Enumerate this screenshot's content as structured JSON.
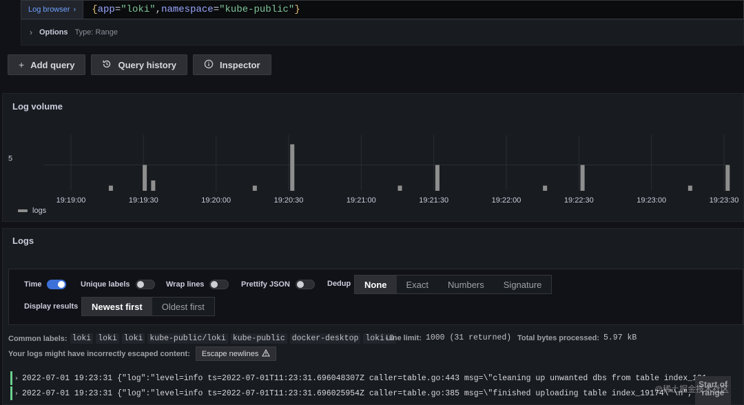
{
  "query": {
    "log_browser_label": "Log browser",
    "log_browser_chevron": "›",
    "tokens": [
      {
        "t": "{",
        "c": "q-brace"
      },
      {
        "t": "app",
        "c": "q-key"
      },
      {
        "t": "=",
        "c": "q-op"
      },
      {
        "t": "\"loki\"",
        "c": "q-val"
      },
      {
        "t": ",",
        "c": "q-op"
      },
      {
        "t": "namespace",
        "c": "q-key"
      },
      {
        "t": "=",
        "c": "q-op"
      },
      {
        "t": "\"kube-public\"",
        "c": "q-val"
      },
      {
        "t": "}",
        "c": "q-brace"
      }
    ],
    "options_label": "Options",
    "options_type": "Type: Range"
  },
  "toolbar": {
    "add_query": "Add query",
    "query_history": "Query history",
    "inspector": "Inspector"
  },
  "volume": {
    "title": "Log volume",
    "legend": "logs",
    "colors": {
      "bar": "#8e8e8e",
      "grid": "#2a2d33",
      "text": "#ccccdc"
    }
  },
  "chart_data": {
    "type": "bar",
    "title": "Log volume",
    "xlabel": "",
    "ylabel": "",
    "y_ticks": [
      5
    ],
    "ylim": [
      0,
      10
    ],
    "x_ticks": [
      "19:19:00",
      "19:19:30",
      "19:20:00",
      "19:20:30",
      "19:21:00",
      "19:21:30",
      "19:22:00",
      "19:22:30",
      "19:23:00",
      "19:23:30"
    ],
    "x_range_seconds": [
      0,
      270
    ],
    "grid": true,
    "legend_position": "bottom-left",
    "series": [
      {
        "name": "logs",
        "points": [
          {
            "t": 16.5,
            "v": 1
          },
          {
            "t": 30.5,
            "v": 5
          },
          {
            "t": 34,
            "v": 2
          },
          {
            "t": 76,
            "v": 1
          },
          {
            "t": 91.5,
            "v": 9
          },
          {
            "t": 136,
            "v": 1
          },
          {
            "t": 151.5,
            "v": 5
          },
          {
            "t": 196,
            "v": 1
          },
          {
            "t": 211.5,
            "v": 5
          },
          {
            "t": 256,
            "v": 1
          },
          {
            "t": 271.5,
            "v": 5
          }
        ]
      }
    ]
  },
  "logs": {
    "title": "Logs",
    "controls": {
      "time_label": "Time",
      "time_on": true,
      "unique_labels_label": "Unique labels",
      "unique_labels_on": false,
      "wrap_lines_label": "Wrap lines",
      "wrap_lines_on": false,
      "prettify_json_label": "Prettify JSON",
      "prettify_json_on": false,
      "dedup_label": "Dedup",
      "dedup_options": [
        "None",
        "Exact",
        "Numbers",
        "Signature"
      ],
      "dedup_selected": "None",
      "display_results_label": "Display results",
      "order_options": [
        "Newest first",
        "Oldest first"
      ],
      "order_selected": "Newest first"
    },
    "common_labels_label": "Common labels:",
    "common_labels": [
      "loki",
      "loki",
      "loki",
      "kube-public/loki",
      "kube-public",
      "docker-desktop",
      "loki-0"
    ],
    "line_limit_label": "Line limit:",
    "line_limit_value": "1000 (31 returned)",
    "bytes_label": "Total bytes processed:",
    "bytes_value": "5.97 kB",
    "escape_warning": "Your logs might have incorrectly escaped content:",
    "escape_button": "Escape newlines",
    "lines": [
      {
        "ts": "2022-07-01 19:23:31",
        "text": "{\"log\":\"level=info ts=2022-07-01T11:23:31.696048307Z caller=table.go:443 msg=\\\"cleaning up unwanted dbs from table index_19174"
      },
      {
        "ts": "2022-07-01 19:23:31",
        "text": "{\"log\":\"level=info ts=2022-07-01T11:23:31.696025954Z caller=table.go:385 msg=\\\"finished uploading table index_19174\\\"\\n\", \"stre"
      }
    ],
    "start_of_range": "Start of range"
  },
  "watermark": "@稀土掘金技术社区"
}
